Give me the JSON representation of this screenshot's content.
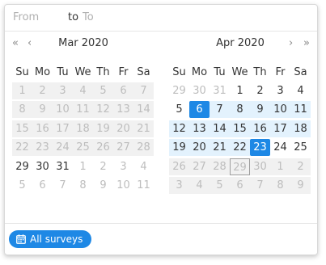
{
  "range": {
    "from_placeholder": "From",
    "separator": "to",
    "to_placeholder": "To"
  },
  "nav": {
    "prev_year": "«",
    "prev_month": "‹",
    "next_month": "›",
    "next_year": "»"
  },
  "weekdays": [
    "Su",
    "Mo",
    "Tu",
    "We",
    "Th",
    "Fr",
    "Sa"
  ],
  "months": [
    {
      "title": "Mar 2020",
      "weeks": [
        [
          {
            "d": "1",
            "s": "dis"
          },
          {
            "d": "2",
            "s": "dis"
          },
          {
            "d": "3",
            "s": "dis"
          },
          {
            "d": "4",
            "s": "dis"
          },
          {
            "d": "5",
            "s": "dis"
          },
          {
            "d": "6",
            "s": "dis"
          },
          {
            "d": "7",
            "s": "dis"
          }
        ],
        [
          {
            "d": "8",
            "s": "dis"
          },
          {
            "d": "9",
            "s": "dis"
          },
          {
            "d": "10",
            "s": "dis"
          },
          {
            "d": "11",
            "s": "dis"
          },
          {
            "d": "12",
            "s": "dis"
          },
          {
            "d": "13",
            "s": "dis"
          },
          {
            "d": "14",
            "s": "dis"
          }
        ],
        [
          {
            "d": "15",
            "s": "dis"
          },
          {
            "d": "16",
            "s": "dis"
          },
          {
            "d": "17",
            "s": "dis"
          },
          {
            "d": "18",
            "s": "dis"
          },
          {
            "d": "19",
            "s": "dis"
          },
          {
            "d": "20",
            "s": "dis"
          },
          {
            "d": "21",
            "s": "dis"
          }
        ],
        [
          {
            "d": "22",
            "s": "dis"
          },
          {
            "d": "23",
            "s": "dis"
          },
          {
            "d": "24",
            "s": "dis"
          },
          {
            "d": "25",
            "s": "dis"
          },
          {
            "d": "26",
            "s": "dis"
          },
          {
            "d": "27",
            "s": "dis"
          },
          {
            "d": "28",
            "s": "dis"
          }
        ],
        [
          {
            "d": "29",
            "s": "cur"
          },
          {
            "d": "30",
            "s": "cur"
          },
          {
            "d": "31",
            "s": "cur"
          },
          {
            "d": "1",
            "s": "out"
          },
          {
            "d": "2",
            "s": "out"
          },
          {
            "d": "3",
            "s": "out"
          },
          {
            "d": "4",
            "s": "out"
          }
        ],
        [
          {
            "d": "5",
            "s": "out"
          },
          {
            "d": "6",
            "s": "out"
          },
          {
            "d": "7",
            "s": "out"
          },
          {
            "d": "8",
            "s": "out"
          },
          {
            "d": "9",
            "s": "out"
          },
          {
            "d": "10",
            "s": "out"
          },
          {
            "d": "11",
            "s": "out"
          }
        ]
      ]
    },
    {
      "title": "Apr 2020",
      "weeks": [
        [
          {
            "d": "29",
            "s": "out"
          },
          {
            "d": "30",
            "s": "out"
          },
          {
            "d": "31",
            "s": "out"
          },
          {
            "d": "1",
            "s": "cur"
          },
          {
            "d": "2",
            "s": "cur"
          },
          {
            "d": "3",
            "s": "cur"
          },
          {
            "d": "4",
            "s": "cur"
          }
        ],
        [
          {
            "d": "5",
            "s": "cur"
          },
          {
            "d": "6",
            "s": "sel"
          },
          {
            "d": "7",
            "s": "inrange"
          },
          {
            "d": "8",
            "s": "inrange"
          },
          {
            "d": "9",
            "s": "inrange"
          },
          {
            "d": "10",
            "s": "inrange"
          },
          {
            "d": "11",
            "s": "inrange"
          }
        ],
        [
          {
            "d": "12",
            "s": "inrange"
          },
          {
            "d": "13",
            "s": "inrange"
          },
          {
            "d": "14",
            "s": "inrange"
          },
          {
            "d": "15",
            "s": "inrange"
          },
          {
            "d": "16",
            "s": "inrange"
          },
          {
            "d": "17",
            "s": "inrange"
          },
          {
            "d": "18",
            "s": "inrange"
          }
        ],
        [
          {
            "d": "19",
            "s": "inrange"
          },
          {
            "d": "20",
            "s": "inrange"
          },
          {
            "d": "21",
            "s": "inrange"
          },
          {
            "d": "22",
            "s": "inrange"
          },
          {
            "d": "23",
            "s": "sel"
          },
          {
            "d": "24",
            "s": "cur"
          },
          {
            "d": "25",
            "s": "cur"
          }
        ],
        [
          {
            "d": "26",
            "s": "dis"
          },
          {
            "d": "27",
            "s": "dis"
          },
          {
            "d": "28",
            "s": "dis"
          },
          {
            "d": "29",
            "s": "dis today"
          },
          {
            "d": "30",
            "s": "dis"
          },
          {
            "d": "1",
            "s": "dis"
          },
          {
            "d": "2",
            "s": "dis"
          }
        ],
        [
          {
            "d": "3",
            "s": "dis"
          },
          {
            "d": "4",
            "s": "dis"
          },
          {
            "d": "5",
            "s": "dis"
          },
          {
            "d": "6",
            "s": "dis"
          },
          {
            "d": "7",
            "s": "dis"
          },
          {
            "d": "8",
            "s": "dis"
          },
          {
            "d": "9",
            "s": "dis"
          }
        ]
      ]
    }
  ],
  "footer": {
    "button_label": "All surveys",
    "button_icon": "calendar-icon"
  },
  "colors": {
    "accent": "#1e88e5",
    "range_fill": "#e3f2fd",
    "disabled_fill": "#f1f1f1"
  }
}
